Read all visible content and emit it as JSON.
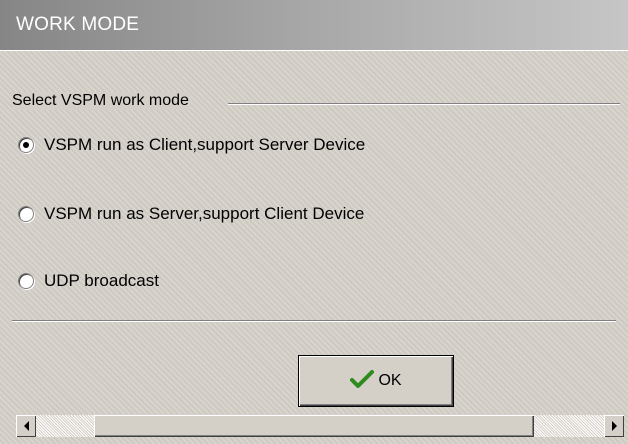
{
  "window": {
    "title": "WORK MODE"
  },
  "group": {
    "label": "Select VSPM work mode",
    "options": [
      {
        "label": "VSPM run as Client,support Server Device",
        "checked": true
      },
      {
        "label": "VSPM run as Server,support Client Device",
        "checked": false
      },
      {
        "label": "UDP broadcast",
        "checked": false
      }
    ]
  },
  "buttons": {
    "ok_label": "OK",
    "ok_icon": "checkmark-icon"
  },
  "scrollbar": {
    "left_icon": "arrow-left-icon",
    "right_icon": "arrow-right-icon"
  },
  "colors": {
    "face": "#d4d0c8",
    "title_gradient_start": "#868686",
    "title_gradient_end": "#c6c6c6",
    "checkmark": "#2e8b1e"
  }
}
